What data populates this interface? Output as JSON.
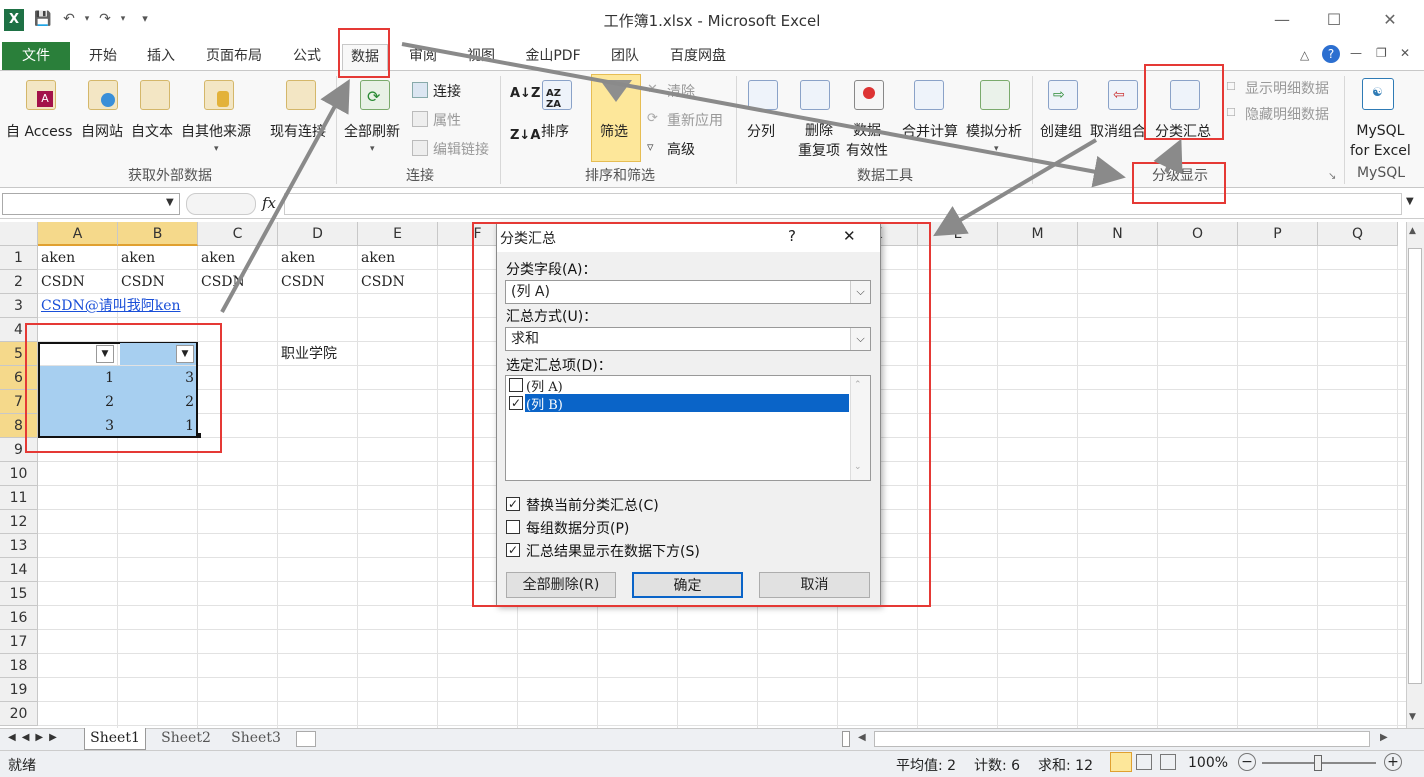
{
  "window": {
    "title": "工作簿1.xlsx - Microsoft Excel"
  },
  "tabs": [
    "文件",
    "开始",
    "插入",
    "页面布局",
    "公式",
    "数据",
    "审阅",
    "视图",
    "金山PDF",
    "团队",
    "百度网盘"
  ],
  "ribbon": {
    "get_external": {
      "items": [
        "自 Access",
        "自网站",
        "自文本",
        "自其他来源"
      ],
      "label": "获取外部数据"
    },
    "existing_conn": "现有连接",
    "connections": {
      "refresh_all": "全部刷新",
      "small": [
        "连接",
        "属性",
        "编辑链接"
      ],
      "label": "连接"
    },
    "sort_filter": {
      "sort": "排序",
      "filter": "筛选",
      "small": [
        "清除",
        "重新应用",
        "高级"
      ],
      "label": "排序和筛选"
    },
    "data_tools": {
      "items": [
        "分列",
        "删除\n重复项",
        "数据\n有效性",
        "合并计算",
        "模拟分析"
      ],
      "label": "数据工具"
    },
    "outline": {
      "items": [
        "创建组",
        "取消组合",
        "分类汇总"
      ],
      "small": [
        "显示明细数据",
        "隐藏明细数据"
      ],
      "label": "分级显示"
    },
    "mysql": {
      "item": "MySQL\nfor Excel",
      "label": "MySQL"
    }
  },
  "formula_bar": {
    "fx": "fx"
  },
  "columns": [
    "A",
    "B",
    "C",
    "D",
    "E",
    "F",
    "G",
    "H",
    "I",
    "J",
    "K",
    "L",
    "M",
    "N",
    "O",
    "P",
    "Q"
  ],
  "rows": [
    "1",
    "2",
    "3",
    "4",
    "5",
    "6",
    "7",
    "8",
    "9",
    "10",
    "11",
    "12",
    "13",
    "14",
    "15",
    "16",
    "17",
    "18",
    "19",
    "20"
  ],
  "cells": {
    "A1": "aken",
    "B1": "aken",
    "C1": "aken",
    "D1": "aken",
    "E1": "aken",
    "A2": "CSDN",
    "B2": "CSDN",
    "C2": "CSDN",
    "D2": "CSDN",
    "E2": "CSDN",
    "A3": "CSDN@请叫我阿ken",
    "D5": "职业学院",
    "A6": "1",
    "B6": "3",
    "A7": "2",
    "B7": "2",
    "A8": "3",
    "B8": "1"
  },
  "dialog": {
    "title": "分类汇总",
    "help": "?",
    "close": "✕",
    "field_label": "分类字段(A)：",
    "field_value": "(列 A)",
    "method_label": "汇总方式(U)：",
    "method_value": "求和",
    "items_label": "选定汇总项(D)：",
    "items": [
      {
        "label": "(列 A)",
        "checked": false,
        "selected": false
      },
      {
        "label": "(列 B)",
        "checked": true,
        "selected": true
      }
    ],
    "options": [
      {
        "label": "替换当前分类汇总(C)",
        "checked": true
      },
      {
        "label": "每组数据分页(P)",
        "checked": false
      },
      {
        "label": "汇总结果显示在数据下方(S)",
        "checked": true
      }
    ],
    "btn_remove": "全部删除(R)",
    "btn_ok": "确定",
    "btn_cancel": "取消"
  },
  "sheets": [
    "Sheet1",
    "Sheet2",
    "Sheet3"
  ],
  "status": {
    "ready": "就绪",
    "avg": "平均值: 2",
    "count": "计数: 6",
    "sum": "求和: 12",
    "zoom": "100%"
  },
  "colors": {
    "file_tab": "#2a7f3a",
    "highlight": "#e53935",
    "selection": "#a7cff0",
    "header_sel": "#f5d98b"
  }
}
